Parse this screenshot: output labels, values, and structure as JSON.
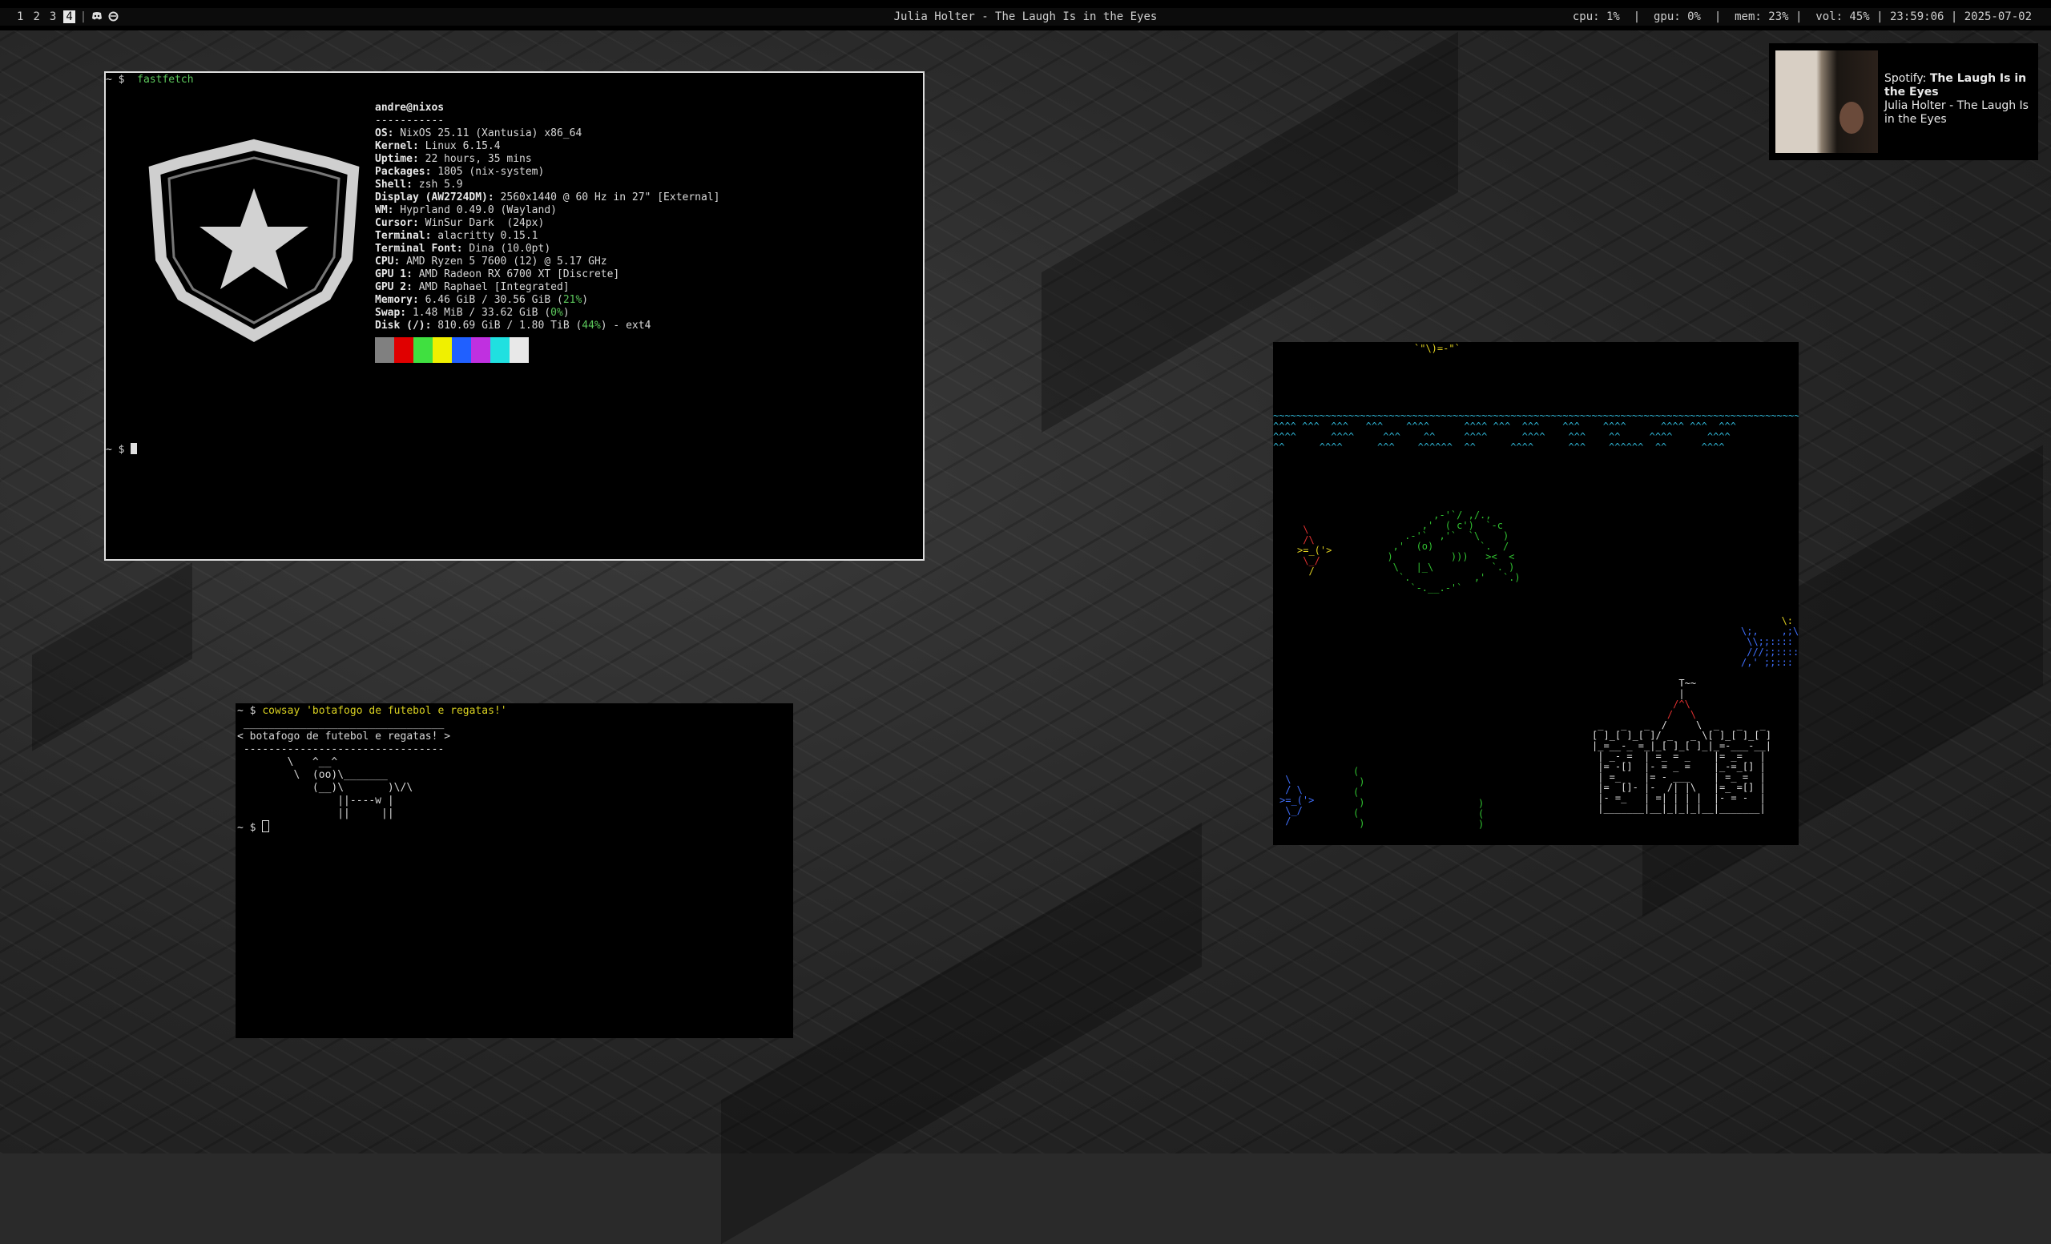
{
  "topbar": {
    "workspaces": [
      "1",
      "2",
      "3",
      "4"
    ],
    "active_workspace": "4",
    "tray_icons": [
      "discord-icon",
      "refresh-icon"
    ],
    "title": "Julia Holter - The Laugh Is in the Eyes",
    "status": "cpu: 1%  |  gpu: 0%  |  mem: 23% |  vol: 45% | 23:59:06 | 2025-07-02"
  },
  "notification": {
    "app": "Spotify:",
    "track": "The Laugh Is in the Eyes",
    "body": "Julia Holter - The Laugh Is in the Eyes"
  },
  "terminal_fastfetch": {
    "prompt": "~ $",
    "command": "fastfetch",
    "userhost": "andre@nixos",
    "separator": "-----------",
    "info": [
      {
        "k": "OS:",
        "v": " NixOS 25.11 (Xantusia) x86_64"
      },
      {
        "k": "Kernel:",
        "v": " Linux 6.15.4"
      },
      {
        "k": "Uptime:",
        "v": " 22 hours, 35 mins"
      },
      {
        "k": "Packages:",
        "v": " 1805 (nix-system)"
      },
      {
        "k": "Shell:",
        "v": " zsh 5.9"
      },
      {
        "k": "Display (AW2724DM):",
        "v": " 2560x1440 @ 60 Hz in 27\" [External]"
      },
      {
        "k": "WM:",
        "v": " Hyprland 0.49.0 (Wayland)"
      },
      {
        "k": "Cursor:",
        "v": " WinSur Dark  (24px)"
      },
      {
        "k": "Terminal:",
        "v": " alacritty 0.15.1"
      },
      {
        "k": "Terminal Font:",
        "v": " Dina (10.0pt)"
      },
      {
        "k": "CPU:",
        "v": " AMD Ryzen 5 7600 (12) @ 5.17 GHz"
      },
      {
        "k": "GPU 1:",
        "v": " AMD Radeon RX 6700 XT [Discrete]"
      },
      {
        "k": "GPU 2:",
        "v": " AMD Raphael [Integrated]"
      }
    ],
    "memory": {
      "k": "Memory:",
      "v": " 6.46 GiB / 30.56 GiB (",
      "pct": "21%",
      "end": ")"
    },
    "swap": {
      "k": "Swap:",
      "v": " 1.48 MiB / 33.62 GiB (",
      "pct": "0%",
      "end": ")"
    },
    "disk": {
      "k": "Disk (/):",
      "v": " 810.69 GiB / 1.80 TiB (",
      "pct": "44%",
      "end": ") - ext4"
    },
    "palette": [
      "#808080",
      "#e00000",
      "#40e040",
      "#f0f000",
      "#2060ff",
      "#c030e0",
      "#20e0e0",
      "#e8e8e8"
    ],
    "prompt2": "~ $"
  },
  "terminal_cowsay": {
    "prompt": "~ $",
    "command": "cowsay 'botafogo de futebol e regatas!'",
    "bubble_top": " ________________________________",
    "bubble_mid": "< botafogo de futebol e regatas! >",
    "bubble_bot": " --------------------------------",
    "cow": [
      "        \\   ^__^",
      "         \\  (oo)\\_______",
      "            (__)\\       )\\/\\",
      "                ||----w |",
      "                ||     ||"
    ],
    "prompt2": "~ $"
  },
  "aquarium": {
    "surface_line": "~~~~~~~~~~~~~~~~~~~~~~~~~~~~~~~~~~~~~~~~~~~~~~~~~~~~~~~~~~~~~~~~~~~~~~~~~~~~~~~~~~~~~~~~~~~~~~~~~~~~~~~~~~~~~~~~~",
    "waves": [
      "^^^^ ^^^  ^^^   ^^^    ^^^^      ^^^^ ^^^  ^^^    ^^^    ^^^^      ^^^^ ^^^  ^^^",
      "^^^^      ^^^^     ^^^    ^^     ^^^^      ^^^^    ^^^    ^^     ^^^^      ^^^^",
      "^^      ^^^^      ^^^    ^^^^^^  ^^      ^^^^      ^^^    ^^^^^^  ^^      ^^^^"
    ],
    "duck": "`\"\\)=-\"`",
    "big_fish": [
      "          ,-'`/ ,/.,",
      "        ,'  ( c')  `-c",
      "     .-'`  ,'`  `\\    )",
      "   ,'  (o)        `.  /",
      "  )          )))   ><  <",
      "   \\   |_\\          `. )",
      "    `.           ,'   `.)",
      "      `-.__.-'`"
    ],
    "left_fish": [
      " \\",
      " /\\",
      ">=_('>",
      " \\_/",
      "  /"
    ],
    "right_fish": [
      "       \\:",
      "\\;,    ,;\\",
      " \\\\;;::::",
      " ///;;::::",
      "/,' ;;:::"
    ],
    "castle": [
      "               T~~",
      "               |",
      "              /^\\",
      "             /   \\",
      " _   _   _  /     \\  _   _   _",
      "[ ]_[ ]_[ ]/ _   _ \\[ ]_[ ]_[ ]",
      "|_=__-_ =_|_[ ]_[ ]_|_=-___-__|",
      " | _- =  | =_ = _    |= _=   |",
      " |= -[]  |- = _ =    |_-=_[] |",
      " | =_    |= - ___    | =_ =  |",
      " |=  []- |-  /| |\\   |=_ =[] |",
      " |- =_   | =| | | |  |- = -  |",
      " |_______|__|_|_|_|__|_______|"
    ]
  }
}
